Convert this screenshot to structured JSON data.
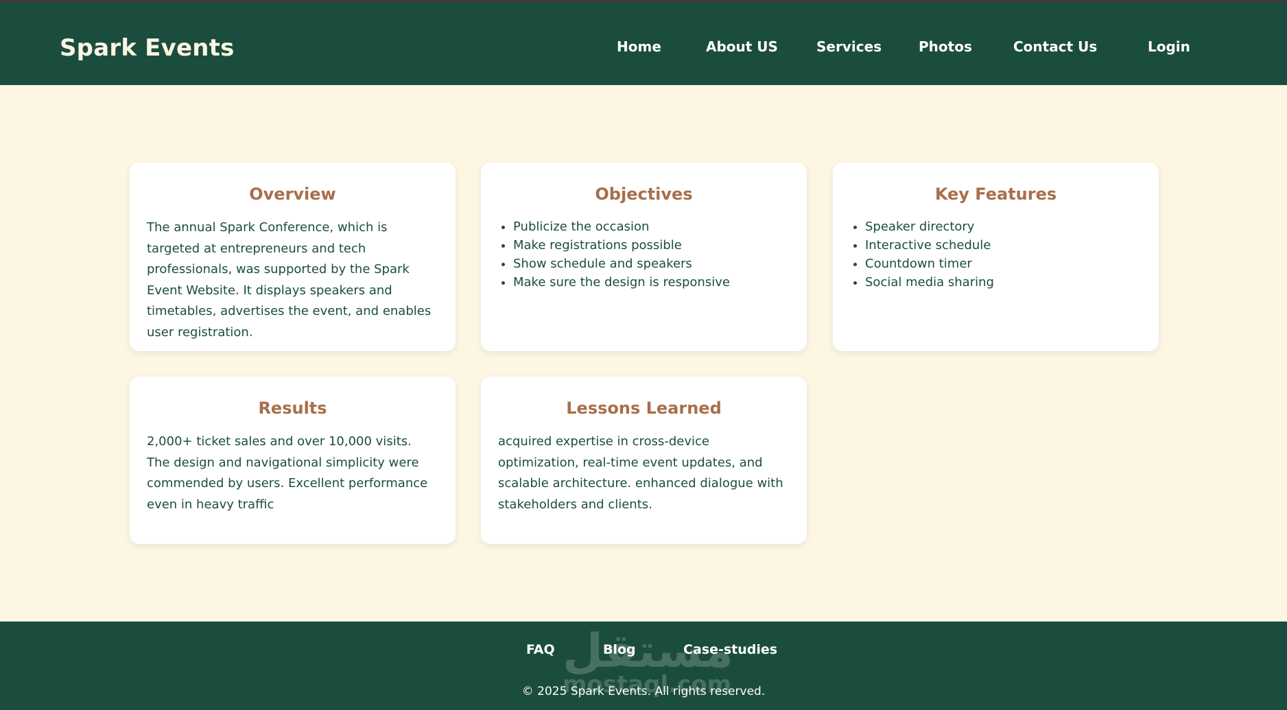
{
  "header": {
    "brand": "Spark Events",
    "nav": [
      "Home",
      "About US",
      "Services",
      "Photos",
      "Contact Us",
      "Login"
    ]
  },
  "cards": {
    "overview": {
      "title": "Overview",
      "text": "The annual Spark Conference, which is targeted at entrepreneurs and tech professionals, was supported by the Spark Event Website. It displays speakers and timetables, advertises the event, and enables user registration."
    },
    "objectives": {
      "title": "Objectives",
      "items": [
        "Publicize the occasion",
        "Make registrations possible",
        "Show schedule and speakers",
        "Make sure the design is responsive"
      ]
    },
    "features": {
      "title": "Key Features",
      "items": [
        "Speaker directory",
        "Interactive schedule",
        "Countdown timer",
        "Social media sharing"
      ]
    },
    "results": {
      "title": "Results",
      "text": "2,000+ ticket sales and over 10,000 visits. The design and navigational simplicity were commended by users. Excellent performance even in heavy traffic"
    },
    "lessons": {
      "title": "Lessons Learned",
      "text": "acquired expertise in cross-device optimization, real-time event updates, and scalable architecture. enhanced dialogue with stakeholders and clients."
    }
  },
  "footer": {
    "links": [
      "FAQ",
      "Blog",
      "Case-studies"
    ],
    "copyright": "© 2025 Spark Events. All rights reserved.",
    "watermark_arabic": "مستقل",
    "watermark_latin": "mostaql.com"
  },
  "colors": {
    "primary": "#1b4d3e",
    "accent": "#a86f4a",
    "background": "#fdf6e3",
    "card": "#ffffff"
  }
}
